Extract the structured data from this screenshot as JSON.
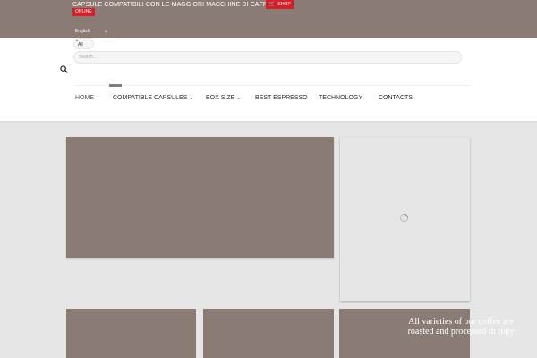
{
  "topbar": {
    "tagline": "CAPSULE COMPATIBILI CON LE MAGGIORI MACCHINE DI CAFFÈ",
    "shop_label": "SHOP",
    "online_label": "ONLINE",
    "language": "English",
    "colors": {
      "bar": "#8b7b75",
      "badge": "#d42128"
    }
  },
  "search": {
    "category": "All",
    "placeholder": "Search..."
  },
  "nav": {
    "items": [
      {
        "label": "HOME",
        "active": true
      },
      {
        "label": "COMPATIBLE CAPSULES",
        "dropdown": true
      },
      {
        "label": "BOX SIZE",
        "dropdown": true
      },
      {
        "label": "BEST ESPRESSO"
      },
      {
        "label": "TECHNOLOGY"
      },
      {
        "label": "CONTACTS"
      }
    ]
  },
  "content": {
    "overlay_text": "All varieties of our coffee are roasted and processed in Italy",
    "card_color": "#8b7b75"
  },
  "icons": {
    "cart": "cart-icon",
    "search": "search-icon",
    "chevron": "chevron-down-icon",
    "loader": "loading-spinner-icon"
  }
}
